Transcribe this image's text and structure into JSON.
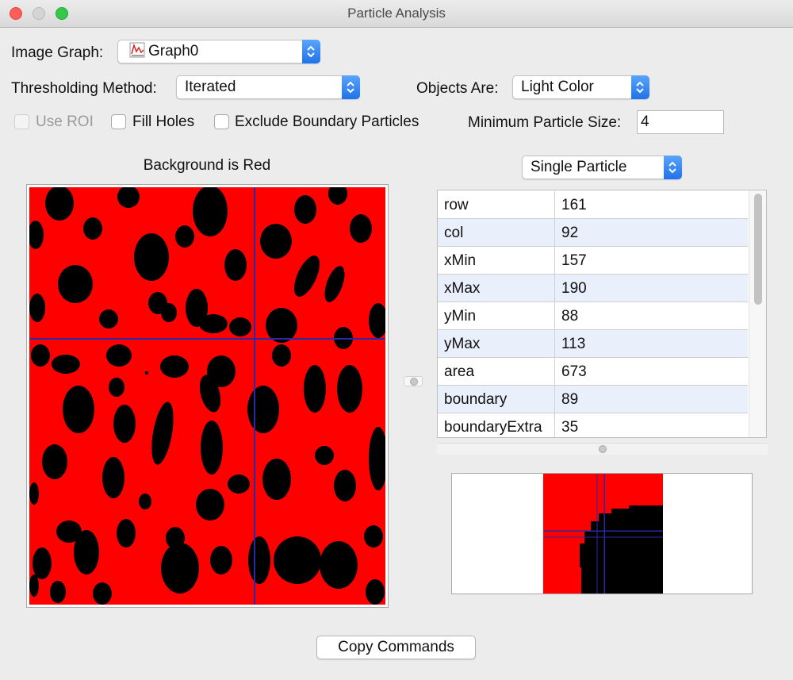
{
  "window": {
    "title": "Particle Analysis"
  },
  "image_graph": {
    "label": "Image Graph:",
    "value": "Graph0",
    "icon": "graph-icon"
  },
  "thresholding": {
    "label": "Thresholding Method:",
    "value": "Iterated"
  },
  "objects_are": {
    "label": "Objects Are:",
    "value": "Light Color"
  },
  "options": {
    "use_roi": {
      "label": "Use ROI",
      "checked": false,
      "enabled": false
    },
    "fill_holes": {
      "label": "Fill Holes",
      "checked": false
    },
    "exclude_boundary": {
      "label": "Exclude Boundary Particles",
      "checked": false
    }
  },
  "min_particle_size": {
    "label": "Minimum Particle Size:",
    "value": "4"
  },
  "main_image": {
    "caption": "Background is Red",
    "background_color": "#ff0000",
    "particle_color": "#000000",
    "crosshair_color": "#2222aa"
  },
  "particle_view": {
    "mode": "Single Particle"
  },
  "table": {
    "rows": [
      {
        "name": "row",
        "value": "161"
      },
      {
        "name": "col",
        "value": "92"
      },
      {
        "name": "xMin",
        "value": "157"
      },
      {
        "name": "xMax",
        "value": "190"
      },
      {
        "name": "yMin",
        "value": "88"
      },
      {
        "name": "yMax",
        "value": "113"
      },
      {
        "name": "area",
        "value": "673"
      },
      {
        "name": "boundary",
        "value": "89"
      },
      {
        "name": "boundaryExtra",
        "value": "35"
      }
    ]
  },
  "copy_button": {
    "label": "Copy Commands"
  }
}
